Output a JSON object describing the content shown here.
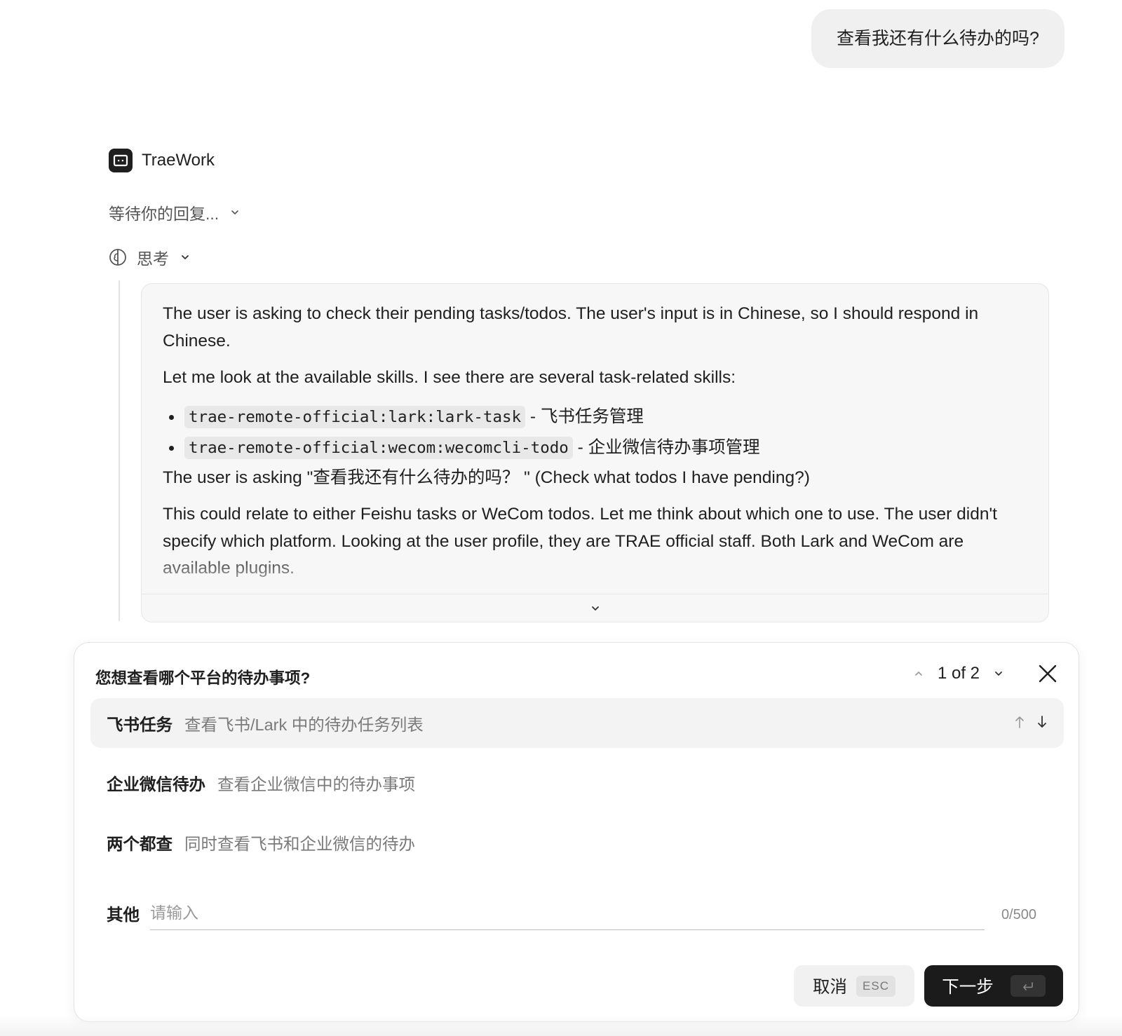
{
  "user_message": "查看我还有什么待办的吗?",
  "assistant": {
    "name": "TraeWork",
    "status": "等待你的回复...",
    "thinking_label": "思考"
  },
  "thinking": {
    "p1": "The user is asking to check their pending tasks/todos. The user's input is in Chinese, so I should respond in Chinese.",
    "p2": "Let me look at the available skills. I see there are several task-related skills:",
    "skills": [
      {
        "code": "trae-remote-official:lark:lark-task",
        "desc": " - 飞书任务管理"
      },
      {
        "code": "trae-remote-official:wecom:wecomcli-todo",
        "desc": " - 企业微信待办事项管理"
      }
    ],
    "p3": "The user is asking \"查看我还有什么待办的吗？ \" (Check what todos I have pending?)",
    "p4": "This could relate to either Feishu tasks or WeCom todos. Let me think about which one to use. The user didn't specify which platform. Looking at the user profile, they are TRAE official staff. Both Lark and WeCom are available plugins."
  },
  "question": {
    "title": "您想查看哪个平台的待办事项?",
    "pager": "1 of 2",
    "options": [
      {
        "label": "飞书任务",
        "desc": "查看飞书/Lark 中的待办任务列表"
      },
      {
        "label": "企业微信待办",
        "desc": "查看企业微信中的待办事项"
      },
      {
        "label": "两个都查",
        "desc": "同时查看飞书和企业微信的待办"
      }
    ],
    "other_label": "其他",
    "other_placeholder": "请输入",
    "counter": "0/500",
    "cancel_label": "取消",
    "cancel_key": "ESC",
    "next_label": "下一步"
  }
}
